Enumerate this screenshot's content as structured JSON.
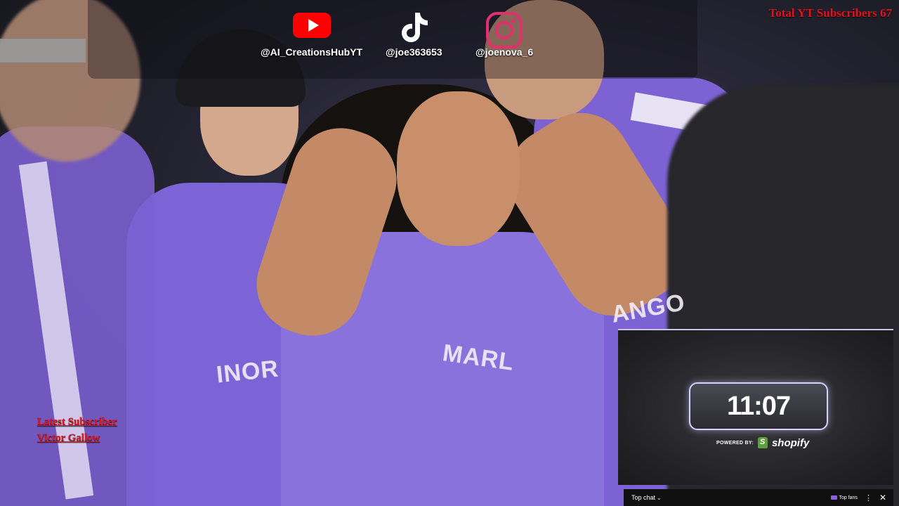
{
  "social": {
    "youtube": {
      "icon": "youtube-icon",
      "handle": "@AI_CreationsHubYT",
      "color": "#ff0000"
    },
    "tiktok": {
      "icon": "tiktok-icon",
      "handle": "@joe363653"
    },
    "instagram": {
      "icon": "instagram-icon",
      "handle": "@joenova_6",
      "color": "#e1306c"
    }
  },
  "overlay": {
    "total_subscribers": "Total YT Subscribers 67",
    "latest_subscriber_label": "Latest Subscriber",
    "latest_subscriber_name": "Victor Gallow"
  },
  "video": {
    "jersey_text_left": "INOR",
    "jersey_text_center": "MARL",
    "jersey_text_right": "ANGO"
  },
  "timer_widget": {
    "time": "11:07",
    "powered_by": "POWERED BY:",
    "brand": "shopify",
    "brand_color": "#5e9e3a"
  },
  "chat": {
    "mode_label": "Top chat",
    "top_fans_label": "Top fans",
    "more_icon": "more-vert-icon",
    "close_icon": "close-icon"
  }
}
